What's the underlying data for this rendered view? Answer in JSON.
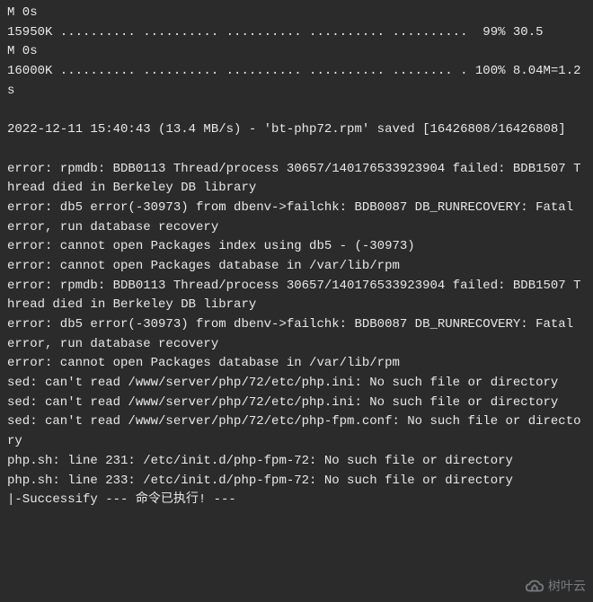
{
  "terminal": {
    "lines": [
      "M 0s",
      "15950K .......... .......... .......... .......... ..........  99% 30.5",
      "M 0s",
      "16000K .......... .......... .......... .......... ........ . 100% 8.04M=1.2s",
      "",
      "2022-12-11 15:40:43 (13.4 MB/s) - 'bt-php72.rpm' saved [16426808/16426808]",
      "",
      "error: rpmdb: BDB0113 Thread/process 30657/140176533923904 failed: BDB1507 Thread died in Berkeley DB library",
      "error: db5 error(-30973) from dbenv->failchk: BDB0087 DB_RUNRECOVERY: Fatal error, run database recovery",
      "error: cannot open Packages index using db5 - (-30973)",
      "error: cannot open Packages database in /var/lib/rpm",
      "error: rpmdb: BDB0113 Thread/process 30657/140176533923904 failed: BDB1507 Thread died in Berkeley DB library",
      "error: db5 error(-30973) from dbenv->failchk: BDB0087 DB_RUNRECOVERY: Fatal error, run database recovery",
      "error: cannot open Packages database in /var/lib/rpm",
      "sed: can't read /www/server/php/72/etc/php.ini: No such file or directory",
      "sed: can't read /www/server/php/72/etc/php.ini: No such file or directory",
      "sed: can't read /www/server/php/72/etc/php-fpm.conf: No such file or directory",
      "php.sh: line 231: /etc/init.d/php-fpm-72: No such file or directory",
      "php.sh: line 233: /etc/init.d/php-fpm-72: No such file or directory",
      "|-Successify --- 命令已执行! ---"
    ]
  },
  "watermark": {
    "text": "树叶云"
  }
}
